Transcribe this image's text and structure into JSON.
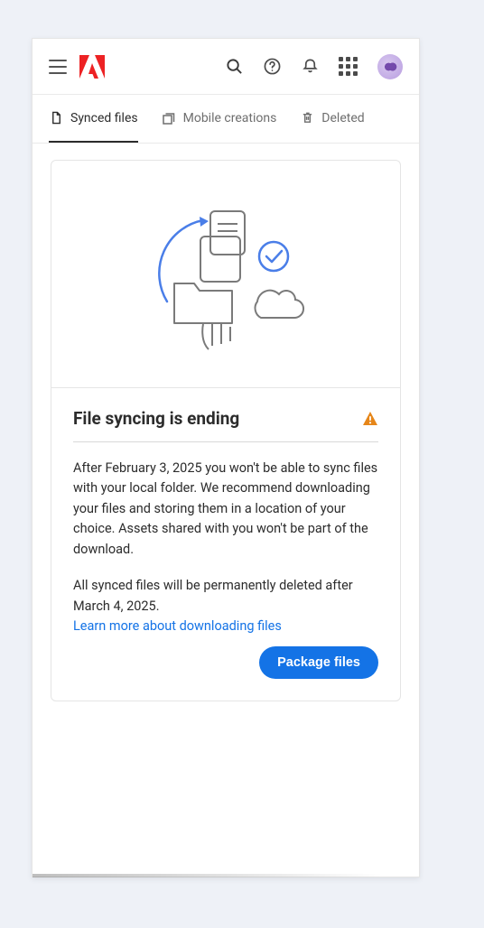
{
  "tabs": {
    "synced": "Synced files",
    "mobile": "Mobile creations",
    "deleted": "Deleted"
  },
  "card": {
    "title": "File syncing is ending",
    "paragraph1": "After February 3, 2025 you won't be able to sync files with your local folder. We recommend downloading your files and storing them in a location of your choice. Assets shared with you won't be part of the download.",
    "paragraph2": "All synced files will be permanently deleted after March 4, 2025.",
    "learn_link": "Learn more about downloading files",
    "action_button": "Package files"
  },
  "icons": {
    "menu": "menu-icon",
    "logo": "adobe-logo",
    "search": "search-icon",
    "help": "help-icon",
    "notifications": "bell-icon",
    "apps": "apps-grid-icon",
    "avatar": "avatar",
    "file": "file-icon",
    "stack": "stack-icon",
    "trash": "trash-icon",
    "warning": "warning-icon"
  }
}
